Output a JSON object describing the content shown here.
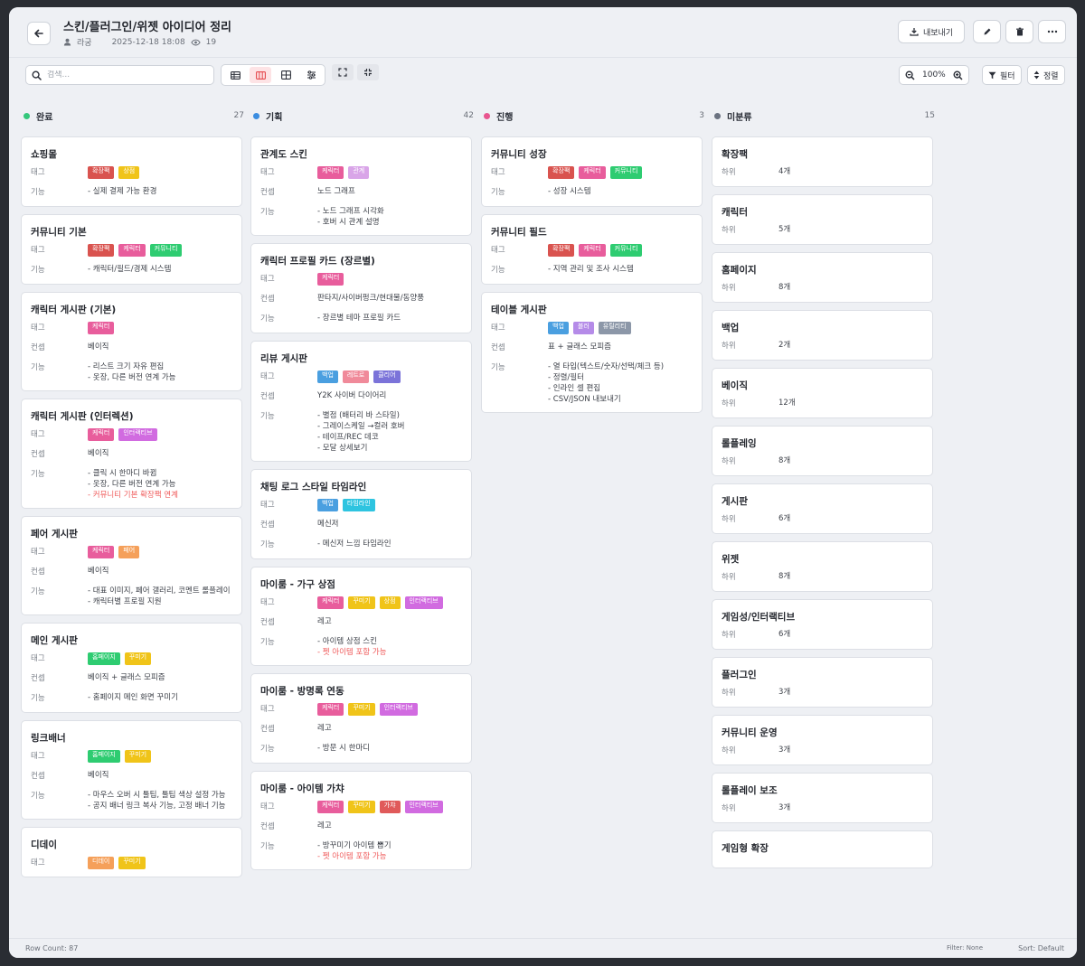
{
  "header": {
    "title": "스킨/플러그인/위젯 아이디어 정리",
    "author": "라궁",
    "date": "2025-12-18 18:08",
    "views": "19",
    "export_label": "내보내기"
  },
  "toolbar": {
    "search_placeholder": "검색...",
    "zoom": "100%",
    "filter_label": "필터",
    "sort_label": "정렬"
  },
  "icons": [
    "back-arrow-icon",
    "user-icon",
    "eye-icon",
    "download-icon",
    "pencil-icon",
    "trash-icon",
    "more-icon",
    "search-icon",
    "table-view-icon",
    "board-view-icon",
    "grid-view-icon",
    "settings-view-icon",
    "expand-icon",
    "collapse-icon",
    "zoom-out-icon",
    "zoom-in-icon",
    "filter-icon",
    "sort-icon"
  ],
  "tag_colors": {
    "확장팩": "#d9534f",
    "상점": "#f0c419",
    "케릭터": "#e85d9c",
    "커뮤니티": "#2ecc71",
    "인터랙티브": "#d16be0",
    "페어": "#f5a05a",
    "홈페이지": "#2ecc71",
    "꾸미기": "#f0c419",
    "디데이": "#f5a05a",
    "관계": "#d9a5e8",
    "백업": "#4a9fe0",
    "레트로": "#f08a9a",
    "클리어": "#7b73d9",
    "타임라인": "#2ec4e0",
    "가챠": "#e05a5a",
    "블러": "#b58be8",
    "유틸리티": "#8c97a8"
  },
  "columns": [
    {
      "name": "완료",
      "count": "27",
      "color": "#34c77b",
      "cards": [
        {
          "title": "쇼핑몰",
          "rows": [
            {
              "label": "태그",
              "tags": [
                "확장팩",
                "상점"
              ]
            },
            {
              "label": "기능",
              "features": [
                "- 실제 결제 가능 환경"
              ]
            }
          ]
        },
        {
          "title": "커뮤니티 기본",
          "rows": [
            {
              "label": "태그",
              "tags": [
                "확장팩",
                "케릭터",
                "커뮤니티"
              ]
            },
            {
              "label": "기능",
              "features": [
                "- 캐릭터/필드/경제 시스템"
              ]
            }
          ]
        },
        {
          "title": "캐릭터 게시판 (기본)",
          "rows": [
            {
              "label": "태그",
              "tags": [
                "케릭터"
              ]
            },
            {
              "label": "컨셉",
              "text": "베이직"
            },
            {
              "label": "기능",
              "features": [
                "- 리스트 크기 자유 편집",
                "- 옷장, 다른 버전 연계 가능"
              ]
            }
          ]
        },
        {
          "title": "캐릭터 게시판 (인터렉션)",
          "rows": [
            {
              "label": "태그",
              "tags": [
                "케릭터",
                "인터랙티브"
              ]
            },
            {
              "label": "컨셉",
              "text": "베이직"
            },
            {
              "label": "기능",
              "features": [
                "- 클릭 시 한마디 바뀜",
                "- 옷장, 다른 버전 연계 가능"
              ],
              "highlight": [
                "- 커뮤니티 기본 확장팩 연계"
              ]
            }
          ]
        },
        {
          "title": "페어 게시판",
          "rows": [
            {
              "label": "태그",
              "tags": [
                "케릭터",
                "페어"
              ]
            },
            {
              "label": "컨셉",
              "text": "베이직"
            },
            {
              "label": "기능",
              "features": [
                "- 대표 이미지, 페어 갤러리, 코멘트 롤플레이",
                "- 캐릭터별 프로필 지원"
              ]
            }
          ]
        },
        {
          "title": "메인 게시판",
          "rows": [
            {
              "label": "태그",
              "tags": [
                "홈페이지",
                "꾸미기"
              ]
            },
            {
              "label": "컨셉",
              "text": "베이직 + 글래스 모피즘"
            },
            {
              "label": "기능",
              "features": [
                "- 홈페이지 메인 화면 꾸미기"
              ]
            }
          ]
        },
        {
          "title": "링크배너",
          "rows": [
            {
              "label": "태그",
              "tags": [
                "홈페이지",
                "꾸미기"
              ]
            },
            {
              "label": "컨셉",
              "text": "베이직"
            },
            {
              "label": "기능",
              "features": [
                "- 마우스 오버 시 툴팁, 툴팁 색상 설정 가능",
                "- 공지 배너 링크 복사 기능, 고정 배너 기능"
              ]
            }
          ]
        },
        {
          "title": "디데이",
          "rows": [
            {
              "label": "태그",
              "tags": [
                "디데이",
                "꾸미기"
              ]
            }
          ]
        }
      ]
    },
    {
      "name": "기획",
      "count": "42",
      "color": "#3b8de0",
      "cards": [
        {
          "title": "관계도 스킨",
          "rows": [
            {
              "label": "태그",
              "tags": [
                "케릭터",
                "관계"
              ]
            },
            {
              "label": "컨셉",
              "text": "노드 그래프"
            },
            {
              "label": "기능",
              "features": [
                "- 노드 그래프 시각화",
                "- 호버 시 관계 설명"
              ]
            }
          ]
        },
        {
          "title": "캐릭터 프로필 카드 (장르별)",
          "rows": [
            {
              "label": "태그",
              "tags": [
                "케릭터"
              ]
            },
            {
              "label": "컨셉",
              "text": "판타지/사이버펑크/현대물/동양풍"
            },
            {
              "label": "기능",
              "features": [
                "- 장르별 테마 프로필 카드"
              ]
            }
          ]
        },
        {
          "title": "리뷰 게시판",
          "rows": [
            {
              "label": "태그",
              "tags": [
                "백업",
                "레트로",
                "클리어"
              ]
            },
            {
              "label": "컨셉",
              "text": "Y2K 사이버 다이어리"
            },
            {
              "label": "기능",
              "features": [
                "- 별점 (배터리 바 스타일)",
                "- 그레이스케일 →컬러 호버",
                "- 테이프/REC 데코",
                "- 모달 상세보기"
              ]
            }
          ]
        },
        {
          "title": "채팅 로그 스타일 타임라인",
          "rows": [
            {
              "label": "태그",
              "tags": [
                "백업",
                "타임라인"
              ]
            },
            {
              "label": "컨셉",
              "text": "메신저"
            },
            {
              "label": "기능",
              "features": [
                "- 메신저 느낌 타임라인"
              ]
            }
          ]
        },
        {
          "title": "마이룸 - 가구 상점",
          "rows": [
            {
              "label": "태그",
              "tags": [
                "케릭터",
                "꾸미기",
                "상점",
                "인터랙티브"
              ]
            },
            {
              "label": "컨셉",
              "text": "레고"
            },
            {
              "label": "기능",
              "features": [
                "- 아이템 상점 스킨"
              ],
              "highlight": [
                "- 펫 아이템 포함 가능"
              ]
            }
          ]
        },
        {
          "title": "마이룸 - 방명록 연동",
          "rows": [
            {
              "label": "태그",
              "tags": [
                "케릭터",
                "꾸미기",
                "인터랙티브"
              ]
            },
            {
              "label": "컨셉",
              "text": "레고"
            },
            {
              "label": "기능",
              "features": [
                "- 방문 시 한마디"
              ]
            }
          ]
        },
        {
          "title": "마이룸 - 아이템 가챠",
          "rows": [
            {
              "label": "태그",
              "tags": [
                "케릭터",
                "꾸미기",
                "가챠",
                "인터랙티브"
              ]
            },
            {
              "label": "컨셉",
              "text": "레고"
            },
            {
              "label": "기능",
              "features": [
                "- 방꾸미기 아이템 뽑기"
              ],
              "highlight": [
                "- 펫 아이템 포함 가능"
              ]
            }
          ]
        }
      ]
    },
    {
      "name": "진행",
      "count": "3",
      "color": "#e8558f",
      "cards": [
        {
          "title": "커뮤니티 성장",
          "rows": [
            {
              "label": "태그",
              "tags": [
                "확장팩",
                "케릭터",
                "커뮤니티"
              ]
            },
            {
              "label": "기능",
              "features": [
                "- 성장 시스템"
              ]
            }
          ]
        },
        {
          "title": "커뮤니티 필드",
          "rows": [
            {
              "label": "태그",
              "tags": [
                "확장팩",
                "케릭터",
                "커뮤니티"
              ]
            },
            {
              "label": "기능",
              "features": [
                "- 지역 관리 및 조사 시스템"
              ]
            }
          ]
        },
        {
          "title": "테이블 게시판",
          "rows": [
            {
              "label": "태그",
              "tags": [
                "백업",
                "블러",
                "유틸리티"
              ]
            },
            {
              "label": "컨셉",
              "text": "표 + 글래스 모피즘"
            },
            {
              "label": "기능",
              "features": [
                "- 열 타입(텍스트/숫자/선택/체크 등)",
                "- 정렬/필터",
                "- 인라인 셀 편집",
                "- CSV/JSON 내보내기"
              ]
            }
          ]
        }
      ]
    },
    {
      "name": "미분류",
      "count": "15",
      "color": "#6b7280",
      "cards": [
        {
          "title": "확장팩",
          "rows": [
            {
              "label": "하위",
              "text": "4개"
            }
          ]
        },
        {
          "title": "캐릭터",
          "rows": [
            {
              "label": "하위",
              "text": "5개"
            }
          ]
        },
        {
          "title": "홈페이지",
          "rows": [
            {
              "label": "하위",
              "text": "8개"
            }
          ]
        },
        {
          "title": "백업",
          "rows": [
            {
              "label": "하위",
              "text": "2개"
            }
          ]
        },
        {
          "title": "베이직",
          "rows": [
            {
              "label": "하위",
              "text": "12개"
            }
          ]
        },
        {
          "title": "롤플레잉",
          "rows": [
            {
              "label": "하위",
              "text": "8개"
            }
          ]
        },
        {
          "title": "게시판",
          "rows": [
            {
              "label": "하위",
              "text": "6개"
            }
          ]
        },
        {
          "title": "위젯",
          "rows": [
            {
              "label": "하위",
              "text": "8개"
            }
          ]
        },
        {
          "title": "게임성/인터랙티브",
          "rows": [
            {
              "label": "하위",
              "text": "6개"
            }
          ]
        },
        {
          "title": "플러그인",
          "rows": [
            {
              "label": "하위",
              "text": "3개"
            }
          ]
        },
        {
          "title": "커뮤니티 운영",
          "rows": [
            {
              "label": "하위",
              "text": "3개"
            }
          ]
        },
        {
          "title": "롤플레이 보조",
          "rows": [
            {
              "label": "하위",
              "text": "3개"
            }
          ]
        },
        {
          "title": "게임형 확장",
          "rows": []
        }
      ]
    }
  ],
  "footer": {
    "row_count": "Row Count: 87",
    "filter": "Filter: None",
    "sort": "Sort: Default"
  }
}
